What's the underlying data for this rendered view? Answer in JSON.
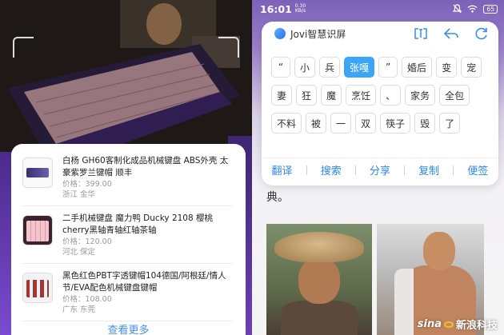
{
  "left_panel": {
    "results": [
      {
        "title": "白杨 GH60客制化成品机械键盘 ABS外壳 太豪紫罗兰键帽 顺丰",
        "price_label": "价格：",
        "price": "399.00",
        "location": "浙江 金华",
        "thumb_icon": "keyboard-thumb-purple"
      },
      {
        "title": "二手机械键盘 魔力鸭 Ducky 2108 樱桃cherry黑轴青轴红轴茶轴",
        "price_label": "价格：",
        "price": "120.00",
        "location": "河北 保定",
        "thumb_icon": "keyboard-thumb-pink"
      },
      {
        "title": "黑色红色PBT字透键帽104德国/阿根廷/情人节/EVA配色机械键盘键帽",
        "price_label": "价格：",
        "price": "108.00",
        "location": "广东 东莞",
        "thumb_icon": "keycap-thumb-red"
      }
    ],
    "see_more": "查看更多"
  },
  "right_panel": {
    "status_bar": {
      "time": "16:01",
      "net_speed_value": "0.30",
      "net_speed_unit": "KB/s",
      "battery": "65"
    },
    "jovi_card": {
      "title": "Jovi智慧识屏",
      "token_rows": [
        [
          {
            "text": "“"
          },
          {
            "text": "小"
          },
          {
            "text": "兵"
          },
          {
            "text": "张嘎",
            "selected": true
          },
          {
            "text": "”"
          },
          {
            "text": "婚后"
          },
          {
            "text": "变"
          },
          {
            "text": "宠"
          }
        ],
        [
          {
            "text": "妻"
          },
          {
            "text": "狂"
          },
          {
            "text": "魔"
          },
          {
            "text": "烹饪"
          },
          {
            "text": "、"
          },
          {
            "text": "家务"
          },
          {
            "text": "全包"
          }
        ],
        [
          {
            "text": "不料"
          },
          {
            "text": "被"
          },
          {
            "text": "一"
          },
          {
            "text": "双"
          },
          {
            "text": "筷子"
          },
          {
            "text": "毁"
          },
          {
            "text": "了"
          }
        ]
      ],
      "actions": [
        "翻译",
        "搜索",
        "分享",
        "复制",
        "便签"
      ]
    },
    "body_text": "典。",
    "watermark": {
      "logo": "sina",
      "text": "新浪科技"
    }
  },
  "colors": {
    "accent_blue": "#3da5f5",
    "link_blue": "#4a8fe6",
    "action_blue": "#2f86e8",
    "purple": "#7b61b8"
  }
}
